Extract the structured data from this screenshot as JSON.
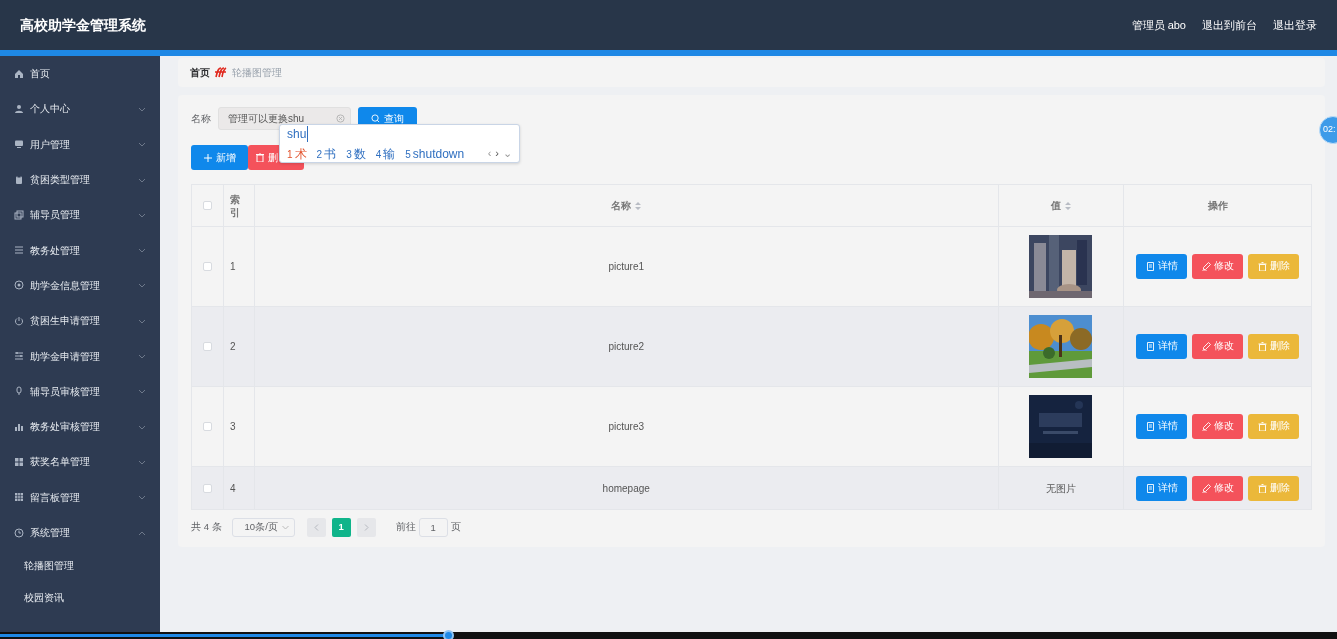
{
  "header": {
    "title": "高校助学金管理系统",
    "links": [
      "管理员 abo",
      "退出到前台",
      "退出登录"
    ]
  },
  "timer": {
    "text": "02:"
  },
  "sidebar": {
    "items": [
      {
        "kind": "link",
        "label": "首页"
      },
      {
        "kind": "menu",
        "label": "个人中心",
        "expanded": false
      },
      {
        "kind": "menu",
        "label": "用户管理",
        "expanded": false
      },
      {
        "kind": "menu",
        "label": "贫困类型管理",
        "expanded": false
      },
      {
        "kind": "menu",
        "label": "辅导员管理",
        "expanded": false
      },
      {
        "kind": "menu",
        "label": "教务处管理",
        "expanded": false
      },
      {
        "kind": "menu",
        "label": "助学金信息管理",
        "expanded": false
      },
      {
        "kind": "menu",
        "label": "贫困生申请管理",
        "expanded": false
      },
      {
        "kind": "menu",
        "label": "助学金申请管理",
        "expanded": false
      },
      {
        "kind": "menu",
        "label": "辅导员审核管理",
        "expanded": false
      },
      {
        "kind": "menu",
        "label": "教务处审核管理",
        "expanded": false
      },
      {
        "kind": "menu",
        "label": "获奖名单管理",
        "expanded": false
      },
      {
        "kind": "menu",
        "label": "留言板管理",
        "expanded": false
      },
      {
        "kind": "menu",
        "label": "系统管理",
        "expanded": true,
        "children": [
          {
            "label": "轮播图管理"
          },
          {
            "label": "校园资讯"
          }
        ]
      }
    ]
  },
  "breadcrumb": [
    "首页",
    "轮播图管理"
  ],
  "search": {
    "label": "名称",
    "value": "管理可以更换shu",
    "button": "查询"
  },
  "toolbar": {
    "add": "新增",
    "delete": "删"
  },
  "ime": {
    "composition": "shu",
    "candidates": [
      {
        "number": "1",
        "text": "术",
        "selected": true
      },
      {
        "number": "2",
        "text": "书",
        "selected": false
      },
      {
        "number": "3",
        "text": "数",
        "selected": false
      },
      {
        "number": "4",
        "text": "输",
        "selected": false
      },
      {
        "number": "5",
        "text": "shutdown",
        "selected": false
      }
    ],
    "nav": [
      "‹",
      "›",
      "⌄"
    ]
  },
  "table": {
    "select_all_checked": false,
    "columns": [
      "",
      "索引",
      "名称",
      "值",
      "操作"
    ],
    "rows": [
      {
        "checked": false,
        "index": "1",
        "name": "picture1",
        "value": {
          "kind": "picture"
        },
        "actions": [
          "详情",
          "修改",
          "删除"
        ]
      },
      {
        "checked": false,
        "index": "2",
        "name": "picture2",
        "value": {
          "kind": "picture"
        },
        "actions": [
          "详情",
          "修改",
          "删除"
        ]
      },
      {
        "checked": false,
        "index": "3",
        "name": "picture3",
        "value": {
          "kind": "picture"
        },
        "actions": [
          "详情",
          "修改",
          "删除"
        ]
      },
      {
        "checked": false,
        "index": "4",
        "name": "homepage",
        "value": {
          "kind": "text",
          "text": "无图片"
        },
        "actions": [
          "详情",
          "修改",
          "删除"
        ]
      }
    ]
  },
  "pagination": {
    "total": "共 4 条",
    "page_size": "10条/页",
    "pages": [
      {
        "label": "1",
        "selected": true
      }
    ],
    "goto_label": "前往",
    "goto_value": "1",
    "goto_suffix": "页"
  },
  "video_progress": {
    "level": 0.336
  }
}
